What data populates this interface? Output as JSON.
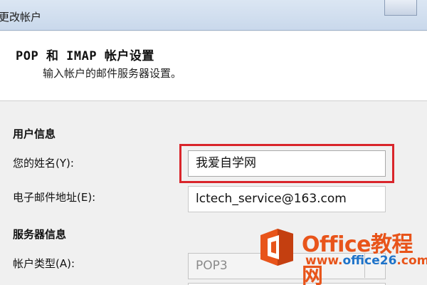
{
  "window": {
    "title": "更改帐户"
  },
  "header": {
    "title": "POP 和 IMAP 帐户设置",
    "subtitle": "输入帐户的邮件服务器设置。"
  },
  "user_info": {
    "section_label": "用户信息",
    "name_label": "您的姓名(Y):",
    "name_value": "我爱自学网",
    "email_label": "电子邮件地址(E):",
    "email_value": "lctech_service@163.com"
  },
  "server_info": {
    "section_label": "服务器信息",
    "account_type_label": "帐户类型(A):",
    "account_type_value": "POP3"
  },
  "watermark": {
    "brand": "Office教程网",
    "url_prefix": "www.",
    "url_domain": "office26",
    "url_suffix": ".com",
    "color": "#e8541a"
  },
  "colors": {
    "highlight": "#d9252b"
  }
}
